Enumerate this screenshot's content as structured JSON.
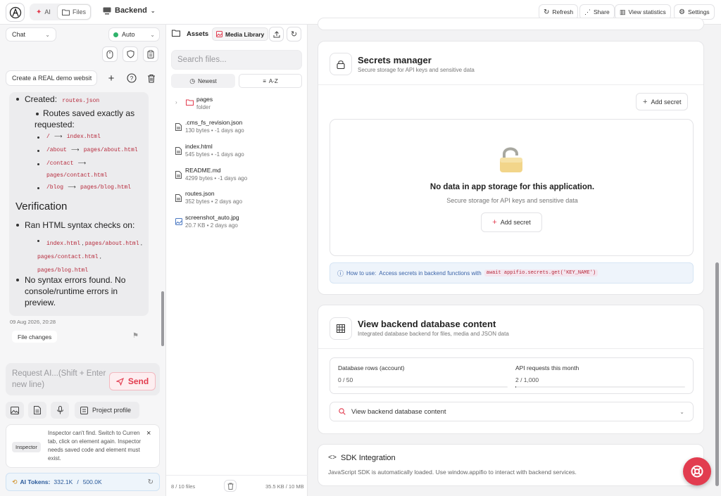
{
  "topbar": {
    "mode_ai": "AI",
    "mode_files": "Files",
    "project_name": "Backend",
    "refresh": "Refresh",
    "share": "Share",
    "view_statistics": "View statistics",
    "settings": "Settings"
  },
  "chat": {
    "mode_select": "Chat",
    "model_select": "Auto",
    "task_title": "Create a REAL demo websit",
    "created_label": "Created:",
    "created_file": "routes.json",
    "routes_text_1": "Routes saved exactly as",
    "routes_text_2": "requested:",
    "routes": [
      {
        "path": "/",
        "arrow": "⟶",
        "target": "index.html"
      },
      {
        "path": "/about",
        "arrow": "⟶",
        "target": "pages/about.html"
      },
      {
        "path": "/contact",
        "arrow": "⟶",
        "target": "pages/contact.html"
      },
      {
        "path": "/blog",
        "arrow": "⟶",
        "target": "pages/blog.html"
      }
    ],
    "verification_heading": "Verification",
    "syntax_check": "Ran HTML syntax checks on:",
    "checked_files": [
      "index.html",
      "pages/about.html",
      "pages/contact.html",
      "pages/blog.html"
    ],
    "no_errors_1": "No syntax errors found. No",
    "no_errors_2": "console/runtime errors in",
    "no_errors_3": "preview.",
    "timestamp": "09 Aug 2026, 20:28",
    "file_changes": "File changes",
    "input_placeholder_1": "Request AI...(Shift + Enter",
    "input_placeholder_2": "new line)",
    "send": "Send",
    "project_profile": "Project profile",
    "inspector_badge": "Inspector",
    "inspector_msg_1": "Inspector can't find. Switch to Curren",
    "inspector_msg_2": "tab, click on element again. Inspector",
    "inspector_msg_3": "needs saved code and element must",
    "inspector_msg_4": "exist.",
    "tokens_label": "AI Tokens:",
    "tokens_used": "332.1K",
    "tokens_sep": "/",
    "tokens_total": "500.0K"
  },
  "files": {
    "tab_assets": "Assets",
    "tab_media": "Media Library",
    "search_placeholder": "Search files...",
    "sort_newest": "Newest",
    "sort_az": "A-Z",
    "folder": {
      "name": "pages",
      "meta": "folder"
    },
    "items": [
      {
        "name": ".cms_fs_revision.json",
        "meta": "130 bytes • -1 days ago",
        "icon": "file-icon"
      },
      {
        "name": "index.html",
        "meta": "545 bytes • -1 days ago",
        "icon": "file-icon"
      },
      {
        "name": "README.md",
        "meta": "4299 bytes • -1 days ago",
        "icon": "file-icon"
      },
      {
        "name": "routes.json",
        "meta": "352 bytes • 2 days ago",
        "icon": "file-icon"
      },
      {
        "name": "screenshot_auto.jpg",
        "meta": "20.7 KB • 2 days ago",
        "icon": "image-icon"
      }
    ],
    "footer_count": "8 / 10 files",
    "footer_size": "35.5 KB / 10 MB"
  },
  "secrets": {
    "title": "Secrets manager",
    "subtitle": "Secure storage for API keys and sensitive data",
    "add_secret": "Add secret",
    "empty_title": "No data in app storage for this application.",
    "empty_sub": "Secure storage for API keys and sensitive data",
    "empty_add": "Add secret",
    "howto_label": "How to use:",
    "howto_text": "Access secrets in backend functions with",
    "howto_code": "await appifio.secrets.get('KEY_NAME')"
  },
  "database": {
    "title": "View backend database content",
    "subtitle": "Integrated database backend for files, media and JSON data",
    "rows_label": "Database rows (account)",
    "rows_value": "0 / 50",
    "rows_fraction": 0,
    "api_label": "API requests this month",
    "api_value": "2 / 1,000",
    "api_fraction": 0.002,
    "view_button": "View backend database content"
  },
  "sdk": {
    "title": "SDK Integration",
    "text": "JavaScript SDK is automatically loaded. Use window.appifio to interact with backend services."
  },
  "colors": {
    "accent": "#e23c4f",
    "howto_bg": "#eef4fb",
    "howto_text": "#3a63a8"
  }
}
